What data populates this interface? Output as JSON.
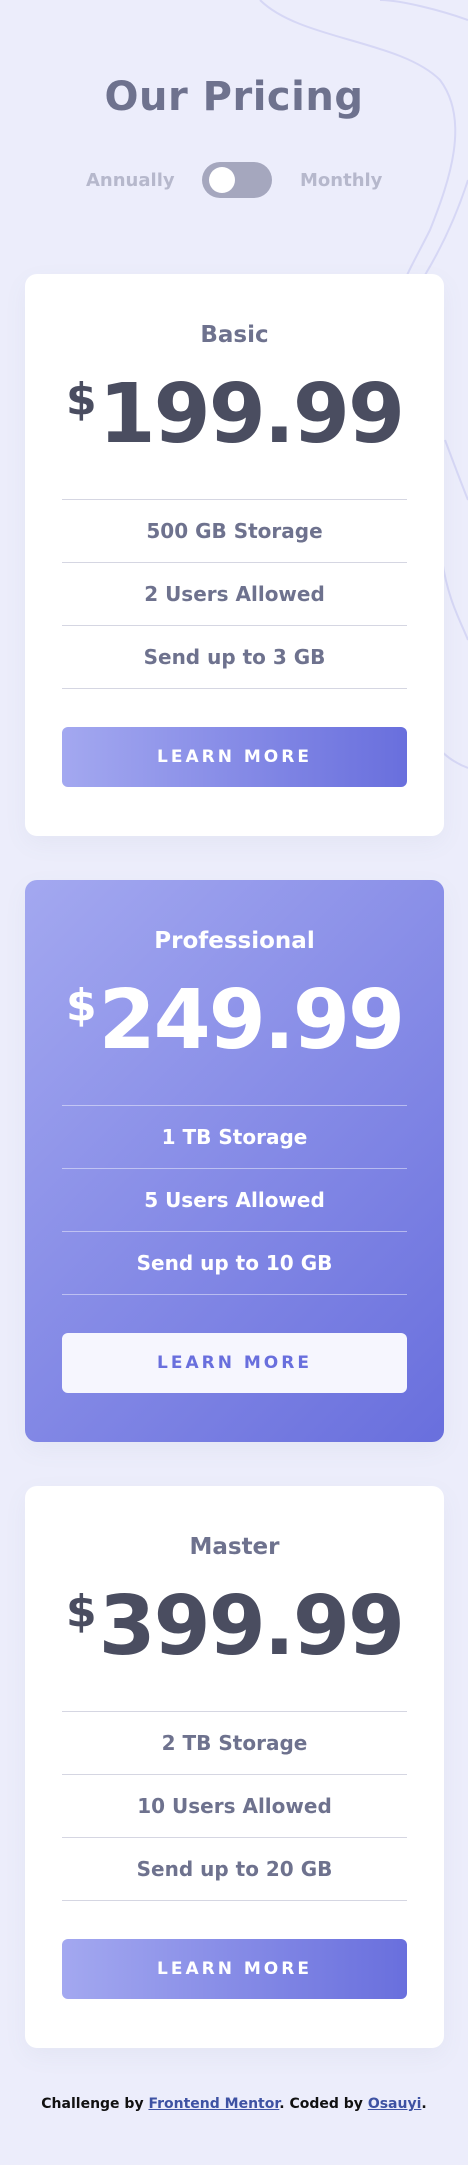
{
  "page": {
    "title": "Our Pricing"
  },
  "toggle": {
    "left_label": "Annually",
    "right_label": "Monthly"
  },
  "plans": [
    {
      "name": "Basic",
      "currency": "$",
      "price": "199.99",
      "features": [
        "500 GB Storage",
        "2 Users Allowed",
        "Send up to 3 GB"
      ],
      "button": "LEARN MORE"
    },
    {
      "name": "Professional",
      "currency": "$",
      "price": "249.99",
      "features": [
        "1 TB Storage",
        "5 Users Allowed",
        "Send up to 10 GB"
      ],
      "button": "LEARN MORE"
    },
    {
      "name": "Master",
      "currency": "$",
      "price": "399.99",
      "features": [
        "2 TB Storage",
        "10 Users Allowed",
        "Send up to 20 GB"
      ],
      "button": "LEARN MORE"
    }
  ],
  "footer": {
    "prefix": "Challenge by ",
    "link1": "Frontend Mentor",
    "middle": ". Coded by ",
    "link2": "Osauyi",
    "suffix": "."
  },
  "colors": {
    "background": "#ECEDFB",
    "accent_start": "#A3A8F0",
    "accent_end": "#696FDD",
    "text": "#6E728E",
    "price": "#4A4D60"
  }
}
